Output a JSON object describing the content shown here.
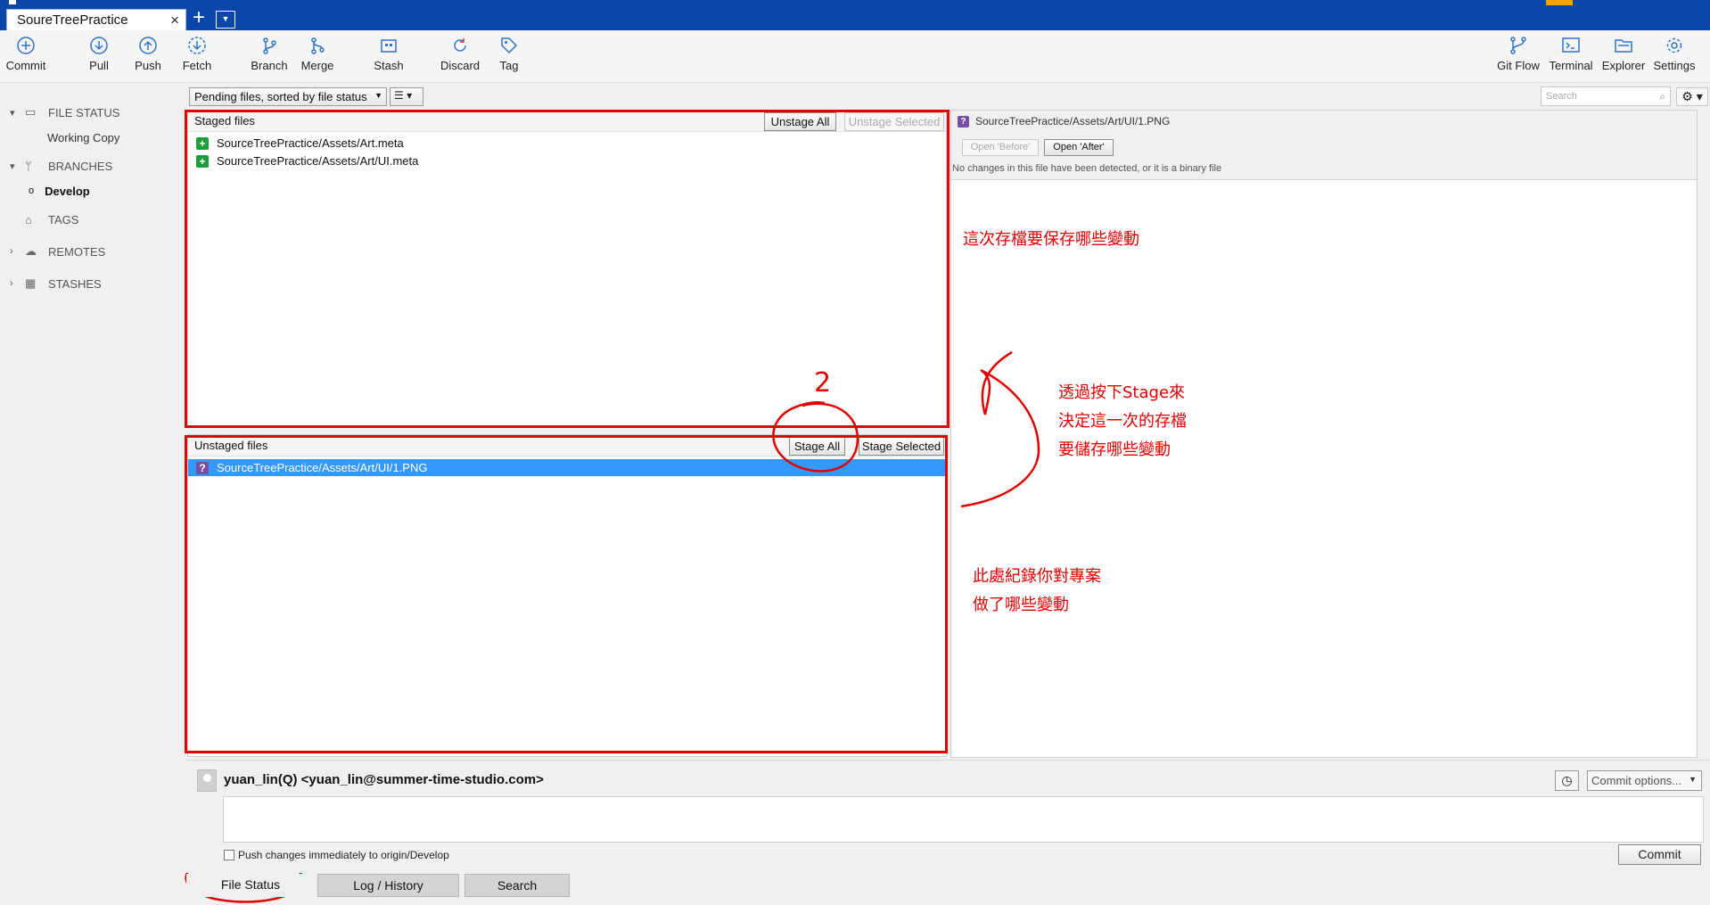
{
  "tab": {
    "title": "SoureTreePractice"
  },
  "toolbar": {
    "commit": "Commit",
    "pull": "Pull",
    "push": "Push",
    "fetch": "Fetch",
    "branch": "Branch",
    "merge": "Merge",
    "stash": "Stash",
    "discard": "Discard",
    "tag": "Tag",
    "git_flow": "Git Flow",
    "terminal": "Terminal",
    "explorer": "Explorer",
    "settings": "Settings"
  },
  "filter": {
    "sort_label": "Pending files, sorted by file status",
    "search_placeholder": "Search"
  },
  "sidebar": {
    "file_status": "FILE STATUS",
    "working_copy": "Working Copy",
    "branches": "BRANCHES",
    "develop": "Develop",
    "tags": "TAGS",
    "remotes": "REMOTES",
    "stashes": "STASHES"
  },
  "staged": {
    "title": "Staged files",
    "unstage_all": "Unstage All",
    "unstage_selected": "Unstage Selected",
    "files": [
      "SourceTreePractice/Assets/Art.meta",
      "SourceTreePractice/Assets/Art/UI.meta"
    ]
  },
  "unstaged": {
    "title": "Unstaged files",
    "stage_all": "Stage All",
    "stage_selected": "Stage Selected",
    "files": [
      "SourceTreePractice/Assets/Art/UI/1.PNG"
    ]
  },
  "diff": {
    "path": "SourceTreePractice/Assets/Art/UI/1.PNG",
    "open_before": "Open 'Before'",
    "open_after": "Open 'After'",
    "message": "No changes in this file have been detected, or it is a binary file"
  },
  "annotations": {
    "staged_note": "這次存檔要保存哪些變動",
    "stage_note_1": "透過按下Stage來",
    "stage_note_2": "決定這一次的存檔",
    "stage_note_3": "要儲存哪些變動",
    "unstaged_note_1": "此處紀錄你對專案",
    "unstaged_note_2": "做了哪些變動",
    "number_mark": "2"
  },
  "commit": {
    "author": "yuan_lin(Q) <yuan_lin@summer-time-studio.com>",
    "options": "Commit options...",
    "push_label": "Push changes immediately to origin/Develop",
    "commit_button": "Commit"
  },
  "bottom_tabs": {
    "file_status": "File Status",
    "log_history": "Log / History",
    "search": "Search"
  },
  "colors": {
    "title_bar": "#0a47a8",
    "selection": "#3399ff",
    "annotation": "#e00000"
  }
}
